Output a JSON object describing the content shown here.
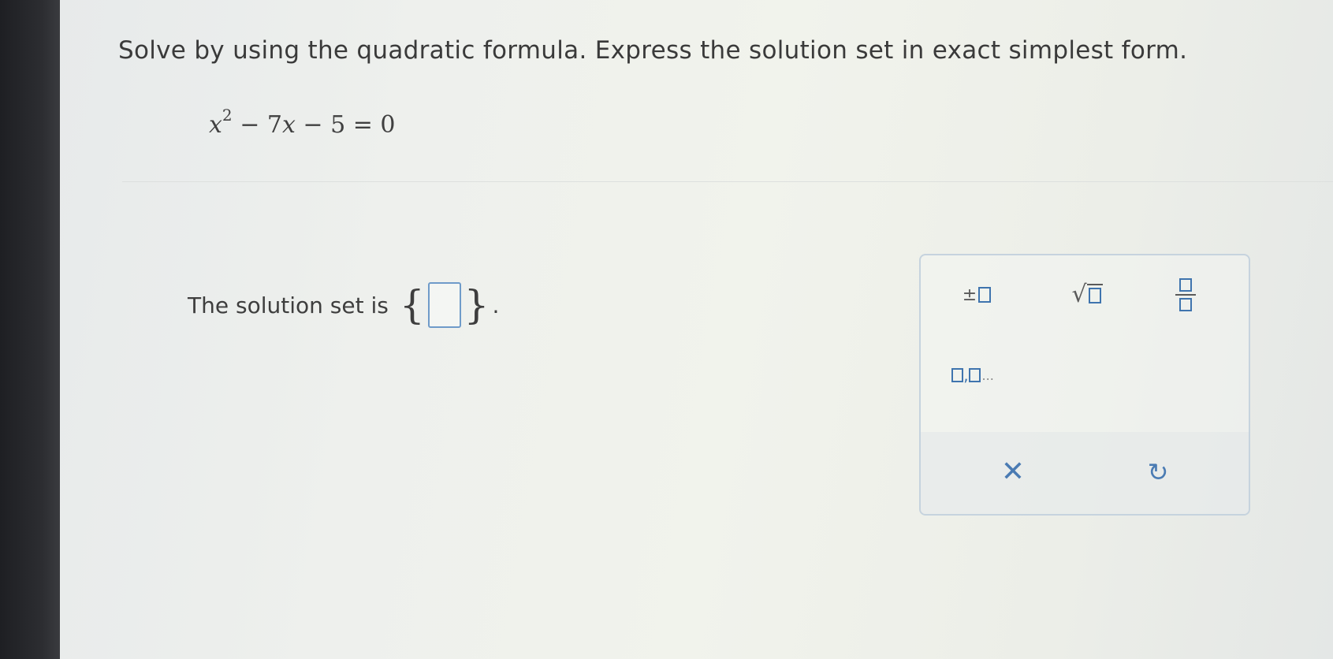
{
  "question": {
    "prompt": "Solve by using the quadratic formula. Express the solution set in exact simplest form."
  },
  "equation": {
    "var": "x",
    "exponent": "2",
    "rest": " − 7",
    "var2": "x",
    "tail": " − 5 = 0"
  },
  "answer": {
    "label": "The solution set is",
    "open_brace": "{",
    "close_brace": "}",
    "period": ".",
    "value": ""
  },
  "palette": {
    "plus_minus": "±",
    "sqrt": "√",
    "list_separator": ",",
    "list_dots": "...",
    "clear": "✕",
    "undo": "↻"
  },
  "colors": {
    "input_border": "#6f9bc9",
    "tool_accent": "#3f74ae",
    "bezel": "#1e1f23"
  }
}
